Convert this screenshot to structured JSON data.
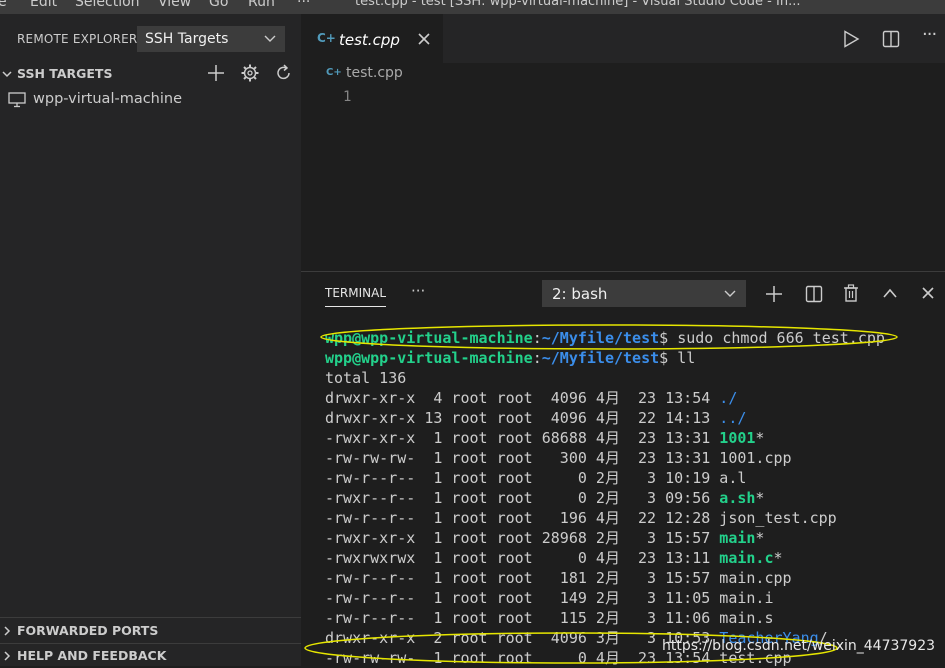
{
  "menu": [
    "e",
    "Edit",
    "Selection",
    "View",
    "Go",
    "Run",
    "···"
  ],
  "window_title": "test.cpp - test [SSH: wpp-virtual-machine] - Visual Studio Code - In...",
  "sidebar": {
    "header": "REMOTE EXPLORER",
    "target_select": "SSH Targets",
    "ssh_section": "SSH TARGETS",
    "host": "wpp-virtual-machine",
    "forwarded_ports": "FORWARDED PORTS",
    "help_feedback": "HELP AND FEEDBACK"
  },
  "editor": {
    "tab_label": "test.cpp",
    "breadcrumb": "test.cpp",
    "line_number": "1"
  },
  "panel": {
    "tab": "TERMINAL",
    "more": "···",
    "terminal_select": "2: bash",
    "lines": [
      {
        "user": "wpp@wpp-virtual-machine",
        "path": "~/Myfile/test",
        "cmd": "$ sudo chmod 666 test.cpp"
      },
      {
        "user": "wpp@wpp-virtual-machine",
        "path": "~/Myfile/test",
        "cmd": "$ ll"
      },
      {
        "text": "total 136"
      },
      {
        "meta": "drwxr-xr-x  4 root root  4096 4月  23 13:54 ",
        "name": "./",
        "kind": "dir",
        "suffix": ""
      },
      {
        "meta": "drwxr-xr-x 13 root root  4096 4月  22 14:13 ",
        "name": "../",
        "kind": "dir",
        "suffix": ""
      },
      {
        "meta": "-rwxr-xr-x  1 root root 68688 4月  23 13:31 ",
        "name": "1001",
        "kind": "exe",
        "suffix": "*"
      },
      {
        "meta": "-rw-rw-rw-  1 root root   300 4月  23 13:31 ",
        "name": "1001.cpp",
        "kind": "file",
        "suffix": ""
      },
      {
        "meta": "-rw-r--r--  1 root root     0 2月   3 10:19 ",
        "name": "a.l",
        "kind": "file",
        "suffix": ""
      },
      {
        "meta": "-rwxr--r--  1 root root     0 2月   3 09:56 ",
        "name": "a.sh",
        "kind": "exe",
        "suffix": "*"
      },
      {
        "meta": "-rw-r--r--  1 root root   196 4月  22 12:28 ",
        "name": "json_test.cpp",
        "kind": "file",
        "suffix": ""
      },
      {
        "meta": "-rwxr-xr-x  1 root root 28968 2月   3 15:57 ",
        "name": "main",
        "kind": "exe",
        "suffix": "*"
      },
      {
        "meta": "-rwxrwxrwx  1 root root     0 4月  23 13:11 ",
        "name": "main.c",
        "kind": "exe",
        "suffix": "*"
      },
      {
        "meta": "-rw-r--r--  1 root root   181 2月   3 15:57 ",
        "name": "main.cpp",
        "kind": "file",
        "suffix": ""
      },
      {
        "meta": "-rw-r--r--  1 root root   149 2月   3 11:05 ",
        "name": "main.i",
        "kind": "file",
        "suffix": ""
      },
      {
        "meta": "-rw-r--r--  1 root root   115 2月   3 11:06 ",
        "name": "main.s",
        "kind": "file",
        "suffix": ""
      },
      {
        "meta": "drwxr-xr-x  2 root root  4096 3月   3 10:53 ",
        "name": "TeacherYang",
        "kind": "dir",
        "suffix": "/"
      },
      {
        "meta": "-rw-rw-rw-  1 root root     0 4月  23 13:54 ",
        "name": "test.cpp",
        "kind": "file",
        "suffix": ""
      }
    ]
  },
  "watermark": "https://blog.csdn.net/weixin_44737923",
  "colors": {
    "prompt_user": "#23d18b",
    "prompt_path": "#3b8eea",
    "annotation_ellipse": "#e6e600",
    "cpp_icon": "#519aba"
  }
}
